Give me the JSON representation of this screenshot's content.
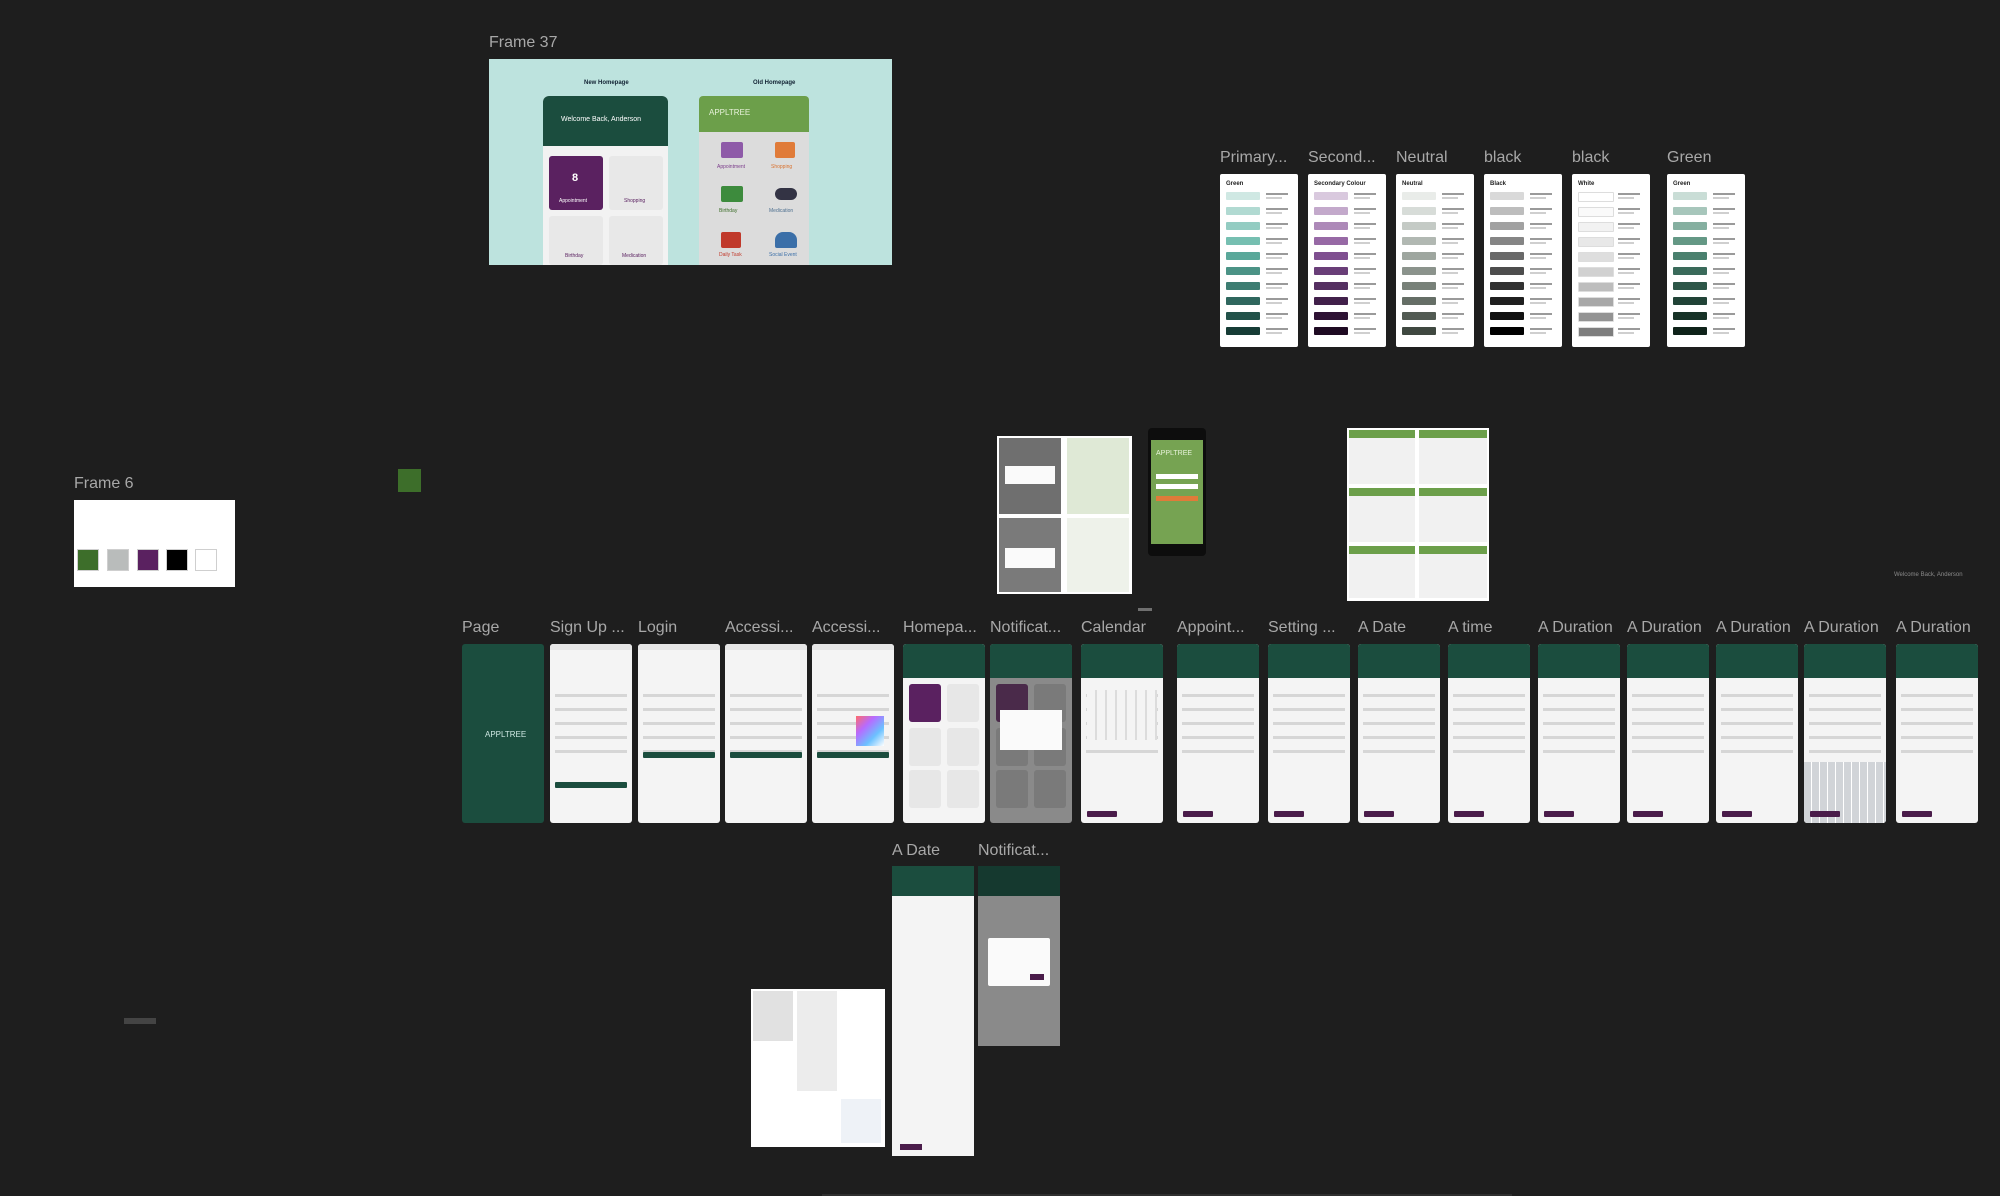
{
  "canvas": {
    "frame37": {
      "label": "Frame 37",
      "new_homepage": "New Homepage",
      "old_homepage": "Old Homepage",
      "welcome": "Welcome Back, Anderson",
      "app_name": "APPLTREE",
      "tiles_new": [
        "Appointment",
        "Shopping",
        "Birthday",
        "Medication"
      ],
      "tiles_old": [
        "Appointment",
        "Shopping",
        "Birthday",
        "Medication",
        "Daily Task",
        "Social Event"
      ],
      "badge_number": "8"
    },
    "frame6": {
      "label": "Frame 6",
      "colors": [
        "#3d6e2a",
        "#b9bcbb",
        "#5a2160",
        "#000000",
        "#ffffff"
      ]
    },
    "palettes": [
      {
        "label": "Primary...",
        "title": "Green"
      },
      {
        "label": "Second...",
        "title": "Secondary Colour"
      },
      {
        "label": "Neutral",
        "title": "Neutral"
      },
      {
        "label": "black",
        "title": "Black"
      },
      {
        "label": "black",
        "title": "White"
      },
      {
        "label": "Green",
        "title": "Green"
      }
    ],
    "screens_row": [
      {
        "label": "Page"
      },
      {
        "label": "Sign Up ..."
      },
      {
        "label": "Login"
      },
      {
        "label": "Accessi..."
      },
      {
        "label": "Accessi..."
      },
      {
        "label": "Homepa..."
      },
      {
        "label": "Notificat..."
      },
      {
        "label": "Calendar"
      },
      {
        "label": "Appoint..."
      },
      {
        "label": "Setting ..."
      },
      {
        "label": "A Date"
      },
      {
        "label": "A time"
      },
      {
        "label": "A Duration"
      },
      {
        "label": "A Duration"
      },
      {
        "label": "A Duration"
      },
      {
        "label": "A Duration"
      },
      {
        "label": "A Duration"
      }
    ],
    "screens_bottom": [
      {
        "label": "A Date"
      },
      {
        "label": "Notificat..."
      }
    ],
    "splash_text": "APPLTREE",
    "right_caption": "Welcome Back, Anderson"
  },
  "colors": {
    "canvas": "#1e1e1e",
    "primary_green": "#1b4d3e",
    "purple": "#4a1c4a",
    "label": "#a8a8a8"
  }
}
